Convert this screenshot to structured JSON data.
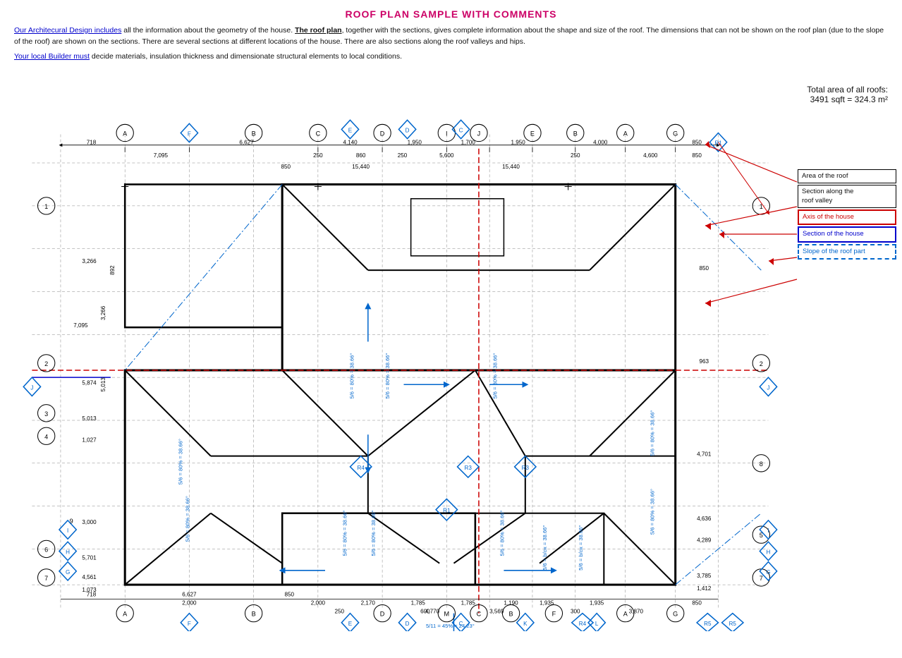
{
  "title": "ROOF PLAN SAMPLE WITH COMMENTS",
  "description": {
    "part1_link": "Our Architecural Design includes",
    "part1_rest": " all the information about the geometry of the house. ",
    "part2_bold": "The roof plan",
    "part2_rest": ", together with the sections, gives complete information about the shape and size of the roof. The dimensions that can not be shown on the roof plan (due to the slope of the roof) are shown on the sections. There are several sections at different locations of the house. There are also sections along the roof valleys and hips."
  },
  "builder_text": {
    "link": "Your local Builder must",
    "rest": " decide materials, insulation thickness and dimensionate structural elements to local conditions."
  },
  "total_area": {
    "label": "Total area of all roofs:",
    "value": "3491 sqft = 324.3 m²"
  },
  "legend": {
    "items": [
      {
        "id": "area-roof",
        "label": "Area of the roof",
        "style": "normal"
      },
      {
        "id": "section-valley",
        "label": "Section along the roof valley",
        "style": "normal"
      },
      {
        "id": "axis-house",
        "label": "Axis of the house",
        "style": "red"
      },
      {
        "id": "section-house",
        "label": "Section of the house",
        "style": "blue"
      },
      {
        "id": "slope-roof",
        "label": "Slope of the roof part",
        "style": "dash-blue"
      }
    ]
  }
}
